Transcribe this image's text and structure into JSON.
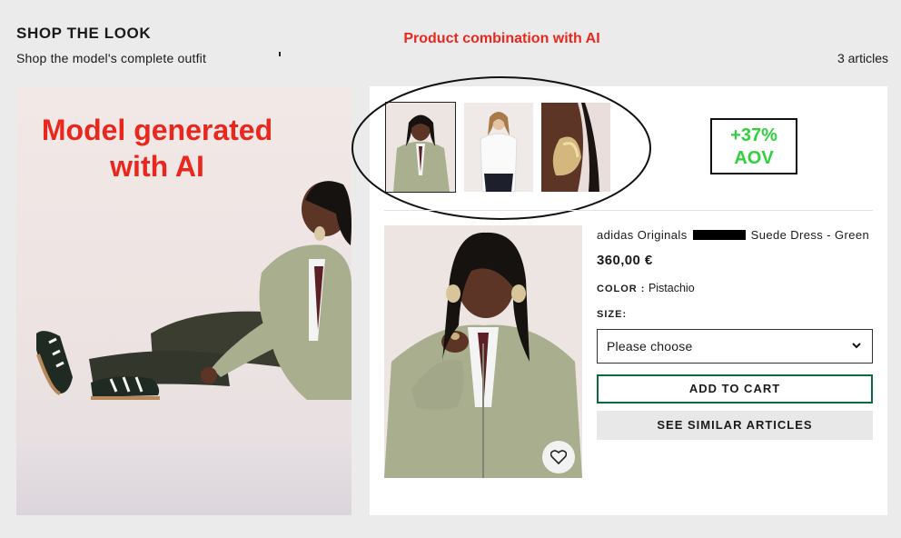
{
  "header": {
    "title": "SHOP THE LOOK",
    "subtitle": "Shop the model's complete outfit",
    "article_count": "3 articles"
  },
  "annotations": {
    "combination": "Product combination with AI",
    "model": "Model generated with AI",
    "aov_value": "+37%",
    "aov_label": "AOV",
    "annotation_color": "#e8281e",
    "aov_color": "#2fd23b"
  },
  "thumbnails": [
    {
      "name": "green-suede-jacket-look",
      "selected": true
    },
    {
      "name": "white-shirt-look",
      "selected": false
    },
    {
      "name": "gold-earring-look",
      "selected": false
    }
  ],
  "product": {
    "brand": "adidas Originals",
    "name": "Suede Dress - Green",
    "price": "360,00 €",
    "color_label": "COLOR :",
    "color_value": "Pistachio",
    "size_label": "SIZE:",
    "size_placeholder": "Please choose",
    "add_to_cart": "ADD TO CART",
    "see_similar": "SEE SIMILAR ARTICLES",
    "accent_color": "#0c6b3c"
  }
}
